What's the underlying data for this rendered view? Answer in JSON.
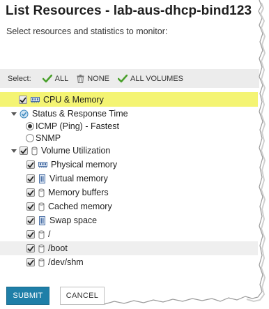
{
  "title": "List Resources - lab-aus-dhcp-bind123",
  "subtitle": "Select resources and statistics to monitor:",
  "select_bar": {
    "label": "Select:",
    "all": "ALL",
    "none": "NONE",
    "all_volumes": "ALL VOLUMES"
  },
  "items": {
    "cpu_memory": "CPU & Memory",
    "status_response": "Status & Response Time",
    "icmp": "ICMP (Ping) - Fastest",
    "snmp": "SNMP",
    "volume_utilization": "Volume Utilization",
    "physical_memory": "Physical memory",
    "virtual_memory": "Virtual memory",
    "memory_buffers": "Memory buffers",
    "cached_memory": "Cached memory",
    "swap_space": "Swap space",
    "root": "/",
    "boot": "/boot",
    "dev_shm": "/dev/shm"
  },
  "buttons": {
    "submit": "SUBMIT",
    "cancel": "CANCEL"
  },
  "colors": {
    "highlight": "#f4f473",
    "accent": "#1f7fa8",
    "check_green": "#4aa02c"
  }
}
